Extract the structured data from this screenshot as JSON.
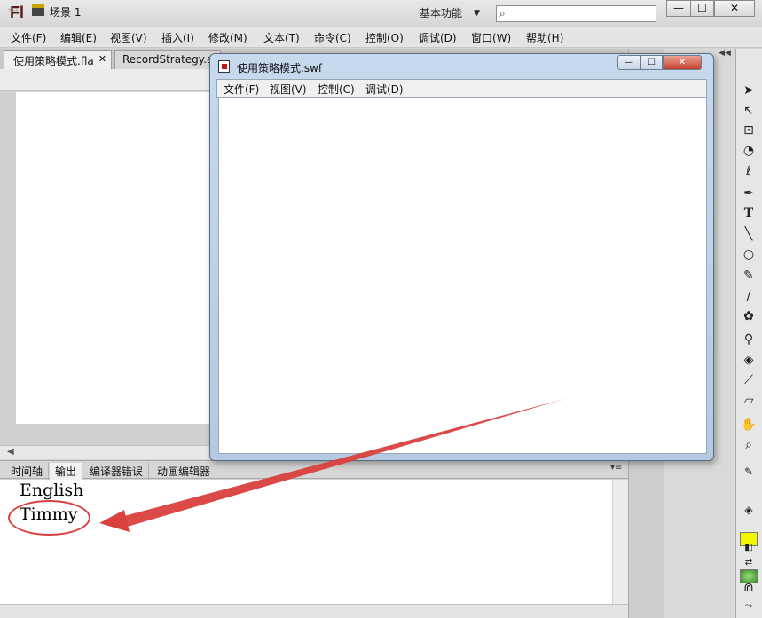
{
  "app": {
    "logo": "Fl",
    "workspace": "基本功能",
    "search": {
      "value": "",
      "placeholder": ""
    }
  },
  "window_controls": {
    "minimize": "—",
    "maximize": "☐",
    "close": "✕"
  },
  "menu": [
    "文件(F)",
    "编辑(E)",
    "视图(V)",
    "插入(I)",
    "修改(M)",
    "文本(T)",
    "命令(C)",
    "控制(O)",
    "调试(D)",
    "窗口(W)",
    "帮助(H)"
  ],
  "doc_tabs": {
    "active": "使用策略模式.fla",
    "close": "✕",
    "second": "RecordStrategy.as"
  },
  "scene": {
    "label": "场景 1"
  },
  "panel_tabs": [
    "时间轴",
    "输出",
    "编译器错误",
    "动画编辑器"
  ],
  "output": {
    "lines": [
      "English",
      "Timmy"
    ]
  },
  "player": {
    "title": "使用策略模式.swf",
    "menu": [
      "文件(F)",
      "视图(V)",
      "控制(C)",
      "调试(D)"
    ]
  },
  "icons": {
    "search": "magnifier-icon",
    "back": "arrow-left-icon",
    "scene": "clapperboard-icon",
    "tools": [
      "selection-tool-icon",
      "subselection-tool-icon",
      "free-transform-icon",
      "3d-rotation-icon",
      "lasso-icon",
      "pen-icon",
      "text-icon",
      "line-icon",
      "oval-icon",
      "pencil-icon",
      "brush-icon",
      "deco-icon",
      "bone-icon",
      "paint-bucket-icon",
      "eyedropper-icon",
      "eraser-icon",
      "hand-icon",
      "zoom-icon"
    ]
  },
  "colors": {
    "annotation": "#d9403d",
    "stroke_color": "#f5f500",
    "fill_color": "#5cb33e"
  }
}
